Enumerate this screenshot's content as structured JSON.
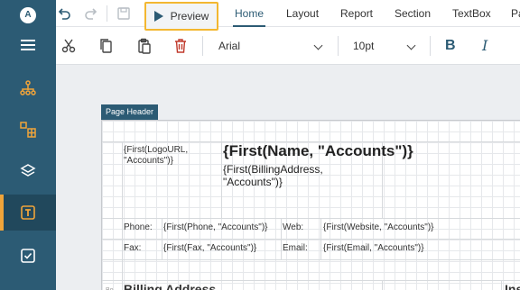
{
  "sidebar": {
    "logo": "A",
    "items": [
      {
        "icon": "hamburger-menu-icon"
      },
      {
        "icon": "org-chart-icon"
      },
      {
        "icon": "data-grid-icon"
      },
      {
        "icon": "layers-icon"
      },
      {
        "icon": "text-box-icon",
        "active": true
      },
      {
        "icon": "checkbox-icon"
      }
    ]
  },
  "topbar": {
    "preview_label": "Preview",
    "tabs": [
      "Home",
      "Layout",
      "Report",
      "Section",
      "TextBox",
      "Pa"
    ],
    "active_tab": "Home"
  },
  "toolbar": {
    "font_family": "Arial",
    "font_size": "10pt",
    "bold_label": "B",
    "italic_label": "I"
  },
  "report": {
    "band_label": "Page Header",
    "logo_expr": "{First(LogoURL,\n\"Accounts\")}",
    "name_expr": "{First(Name, \"Accounts\")}",
    "address_expr": "{First(BillingAddress,\n\"Accounts\")}",
    "phone_label": "Phone:",
    "phone_expr": "{First(Phone, \"Accounts\")}",
    "web_label": "Web:",
    "web_expr": "{First(Website, \"Accounts\")}",
    "fax_label": "Fax:",
    "fax_expr": "{First(Fax, \"Accounts\")}",
    "email_label": "Email:",
    "email_expr": "{First(Email, \"Accounts\")}",
    "billing_heading": "Billing Address",
    "small_label": "Bo",
    "right_heading": "Ins"
  }
}
